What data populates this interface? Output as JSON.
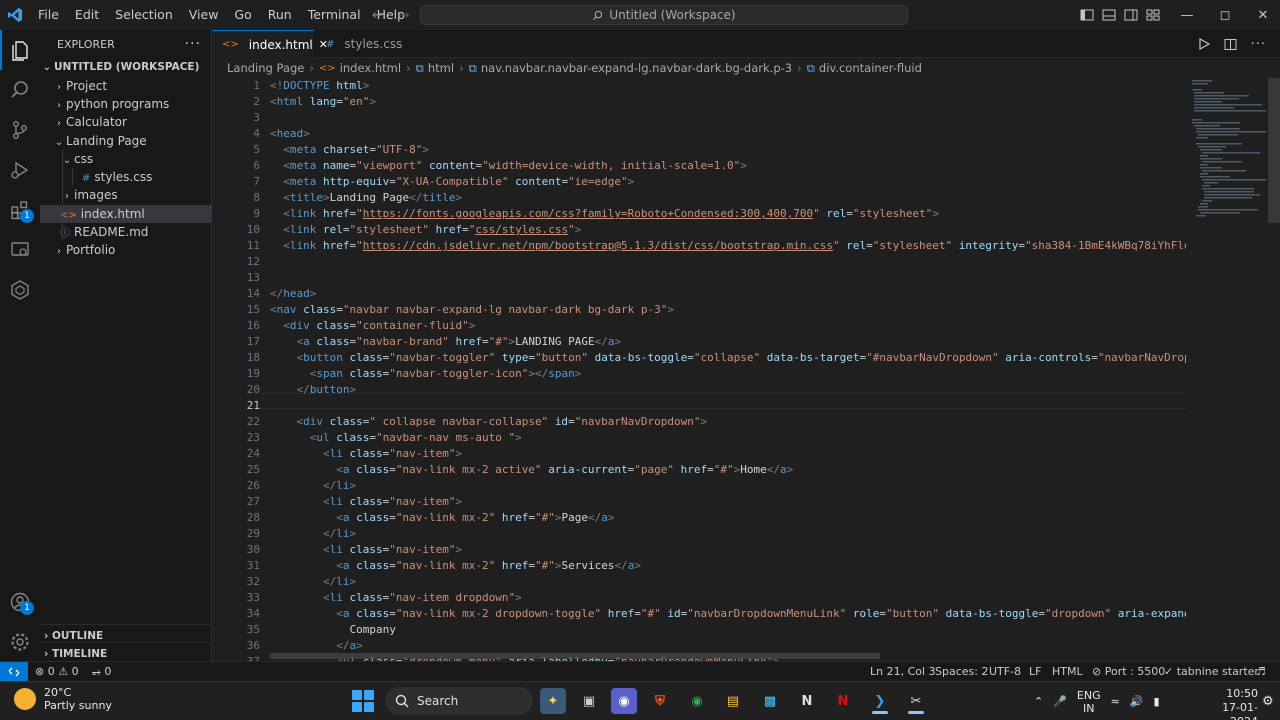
{
  "titlebar": {
    "menus": [
      "File",
      "Edit",
      "Selection",
      "View",
      "Go",
      "Run",
      "Terminal",
      "Help"
    ],
    "command_center": "Untitled (Workspace)"
  },
  "sidebar": {
    "header": "EXPLORER",
    "workspace": "UNTITLED (WORKSPACE)",
    "items": [
      {
        "label": "Project"
      },
      {
        "label": "python programs"
      },
      {
        "label": "Calculator"
      },
      {
        "label": "Landing Page"
      },
      {
        "label": "css"
      },
      {
        "label": "styles.css"
      },
      {
        "label": "images"
      },
      {
        "label": "index.html"
      },
      {
        "label": "README.md"
      },
      {
        "label": "Portfolio"
      }
    ],
    "outline": "OUTLINE",
    "timeline": "TIMELINE"
  },
  "tabs": [
    {
      "label": "index.html",
      "active": true
    },
    {
      "label": "styles.css",
      "active": false
    }
  ],
  "breadcrumb": [
    "Landing Page",
    "index.html",
    "html",
    "nav.navbar.navbar-expand-lg.navbar-dark.bg-dark.p-3",
    "div.container-fluid"
  ],
  "editor": {
    "current_line": 21,
    "first_line": 1,
    "last_line": 37
  },
  "statusbar": {
    "problems": "0",
    "warnings": "0",
    "ports": "0",
    "position": "Ln 21, Col 3",
    "spaces": "Spaces: 2",
    "encoding": "UTF-8",
    "eol": "LF",
    "language": "HTML",
    "port": "Port : 5500",
    "tabnine": "tabnine starter"
  },
  "taskbar": {
    "temperature": "20°C",
    "weather": "Partly sunny",
    "search": "Search",
    "lang": "ENG",
    "region": "IN",
    "time": "10:50",
    "date": "17-01-2024"
  },
  "colors": {
    "accent": "#0078d4",
    "tag": "#569cd6",
    "attr": "#9cdcfe",
    "string": "#ce9178"
  }
}
